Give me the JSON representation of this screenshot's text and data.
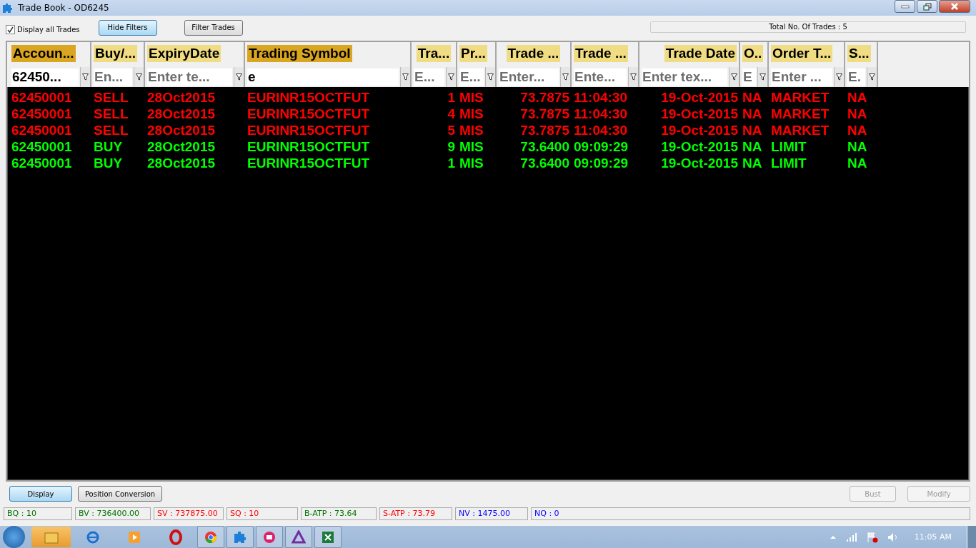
{
  "window": {
    "title": "Trade Book - OD6245"
  },
  "toolbar": {
    "display_all": {
      "label": "Display all Trades",
      "checked": true
    },
    "buttons": [
      {
        "label": "Hide Filters",
        "selected": true
      },
      {
        "label": "Filter Trades",
        "selected": false
      }
    ],
    "total": "Total No. Of Trades : 5"
  },
  "table": {
    "columns": [
      {
        "label": "Accoun...",
        "highlighted": true,
        "filter_value": "62450..."
      },
      {
        "label": "Buy/...",
        "highlighted": false,
        "filter_placeholder": "En..."
      },
      {
        "label": "ExpiryDate",
        "highlighted": false,
        "filter_placeholder": "Enter te..."
      },
      {
        "label": "Trading Symbol",
        "highlighted": true,
        "filter_value": "e"
      },
      {
        "label": "Tra...",
        "highlighted": false,
        "filter_placeholder": "E..."
      },
      {
        "label": "Pr...",
        "highlighted": false,
        "filter_placeholder": "E..."
      },
      {
        "label": "Trade ...",
        "highlighted": false,
        "filter_placeholder": "Enter..."
      },
      {
        "label": "Trade ...",
        "highlighted": false,
        "filter_placeholder": "Ente..."
      },
      {
        "label": "Trade Date",
        "highlighted": false,
        "filter_placeholder": "Enter tex..."
      },
      {
        "label": "O..",
        "highlighted": false,
        "filter_placeholder": "E"
      },
      {
        "label": "Order T...",
        "highlighted": false,
        "filter_placeholder": "Enter ..."
      },
      {
        "label": "S...",
        "highlighted": false,
        "filter_placeholder": "E."
      }
    ],
    "rows": [
      {
        "color": "#ff0000",
        "cells": [
          "62450001",
          "SELL",
          "28Oct2015",
          "EURINR15OCTFUT",
          "1",
          "MIS",
          "73.7875",
          "11:04:30",
          "19-Oct-2015",
          "NA",
          "MARKET",
          "NA"
        ]
      },
      {
        "color": "#ff0000",
        "cells": [
          "62450001",
          "SELL",
          "28Oct2015",
          "EURINR15OCTFUT",
          "4",
          "MIS",
          "73.7875",
          "11:04:30",
          "19-Oct-2015",
          "NA",
          "MARKET",
          "NA"
        ]
      },
      {
        "color": "#ff0000",
        "cells": [
          "62450001",
          "SELL",
          "28Oct2015",
          "EURINR15OCTFUT",
          "5",
          "MIS",
          "73.7875",
          "11:04:30",
          "19-Oct-2015",
          "NA",
          "MARKET",
          "NA"
        ]
      },
      {
        "color": "#00ff00",
        "cells": [
          "62450001",
          "BUY",
          "28Oct2015",
          "EURINR15OCTFUT",
          "9",
          "MIS",
          "73.6400",
          "09:09:29",
          "19-Oct-2015",
          "NA",
          "LIMIT",
          "NA"
        ]
      },
      {
        "color": "#00ff00",
        "cells": [
          "62450001",
          "BUY",
          "28Oct2015",
          "EURINR15OCTFUT",
          "1",
          "MIS",
          "73.6400",
          "09:09:29",
          "19-Oct-2015",
          "NA",
          "LIMIT",
          "NA"
        ]
      }
    ]
  },
  "actions": {
    "left": [
      {
        "label": "Display",
        "selected": true
      },
      {
        "label": "Position Conversion",
        "selected": false
      }
    ],
    "right": [
      {
        "label": "Bust",
        "disabled": true
      },
      {
        "label": "Modify",
        "disabled": true
      }
    ]
  },
  "status_bar": [
    {
      "text": "BQ : 10",
      "color": "#007000"
    },
    {
      "text": "BV : 736400.00",
      "color": "#007000"
    },
    {
      "text": "SV : 737875.00",
      "color": "#ff0000"
    },
    {
      "text": "SQ : 10",
      "color": "#ff0000"
    },
    {
      "text": "B-ATP : 73.64",
      "color": "#007000"
    },
    {
      "text": "S-ATP : 73.79",
      "color": "#ff0000"
    },
    {
      "text": "NV : 1475.00",
      "color": "#0000ff"
    },
    {
      "text": "NQ : 0",
      "color": "#0000ff"
    }
  ],
  "taskbar": {
    "clock": "11:05 AM"
  }
}
